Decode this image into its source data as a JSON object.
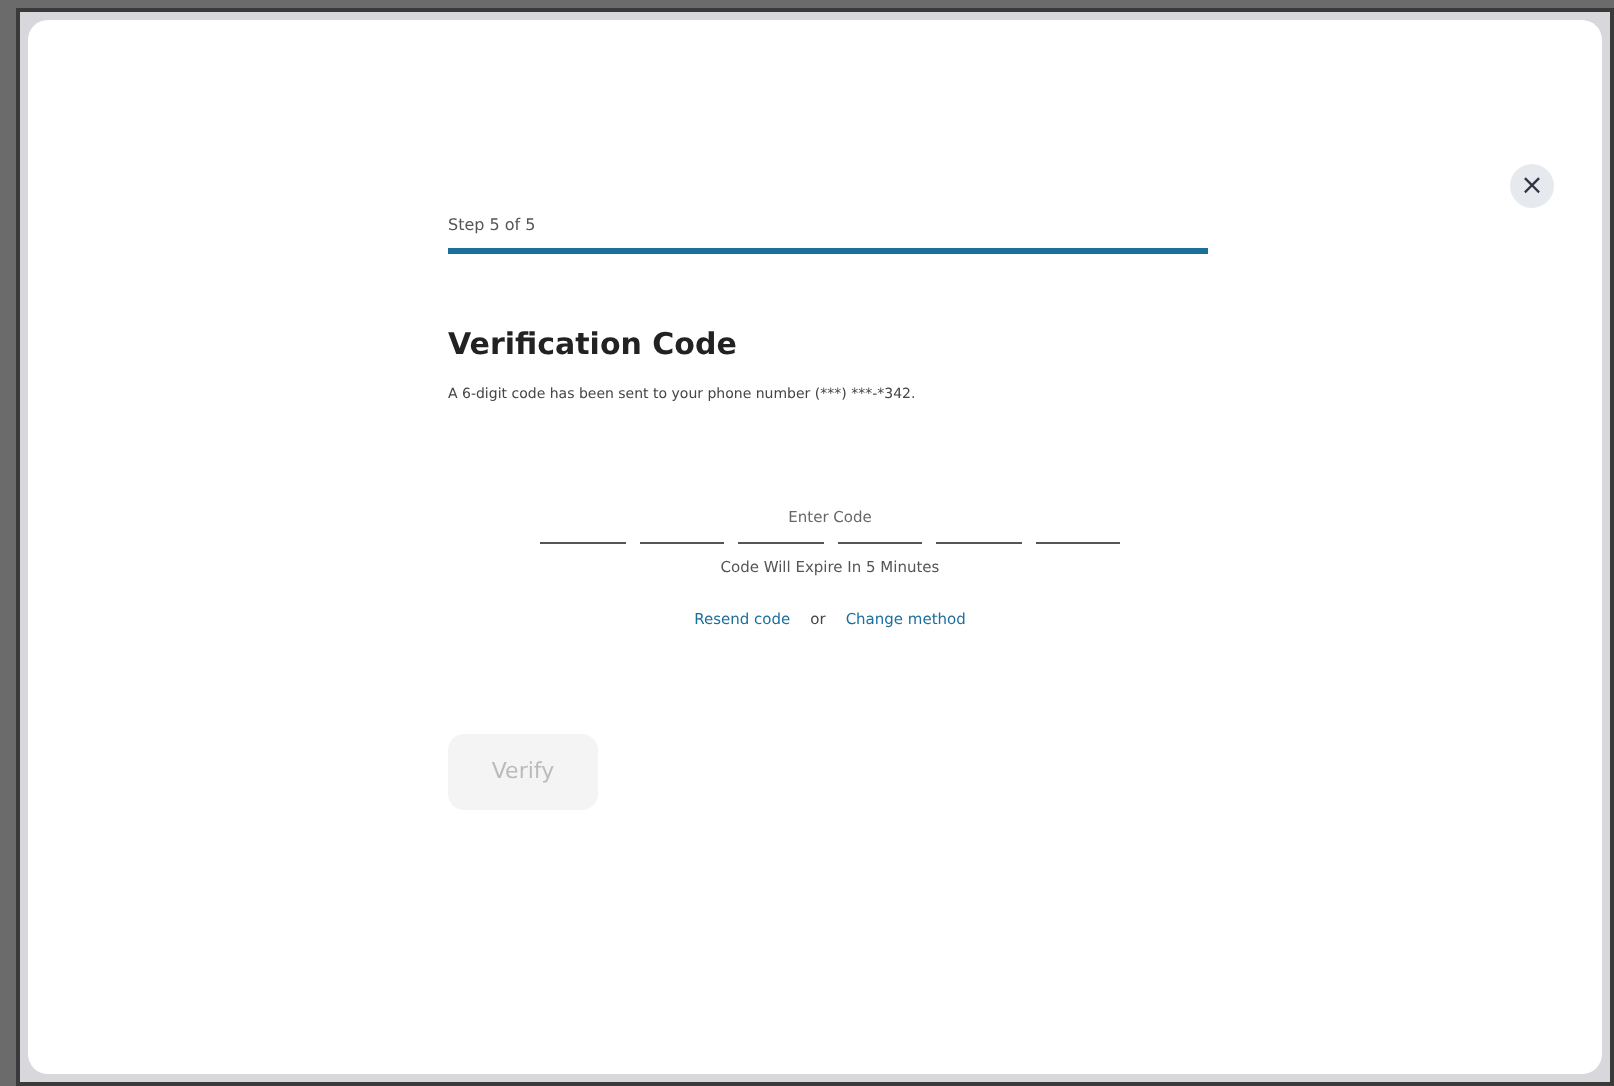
{
  "dialog": {
    "close_button": "×",
    "step_label": "Step 5 of 5",
    "progress": {
      "level": 1
    },
    "title": "Verification Code",
    "description": "A 6-digit code has been sent to your phone number (***) ***-*342.",
    "code_field": {
      "placeholder": "Enter Code",
      "boxes": [
        {
          "kind": "digit"
        },
        {
          "kind": "digit"
        },
        {
          "kind": "digit"
        },
        {
          "kind": "digit"
        },
        {
          "kind": "digit"
        },
        {
          "kind": "digit"
        }
      ]
    },
    "expiry_note": "Code Will Expire In 5 Minutes",
    "links": [
      {
        "kind": "link",
        "text": "Resend code"
      },
      {
        "kind": "text",
        "text": "or"
      },
      {
        "kind": "link",
        "text": "Change method"
      }
    ],
    "verify_button": {
      "label": "Verify",
      "disabled": true
    }
  }
}
